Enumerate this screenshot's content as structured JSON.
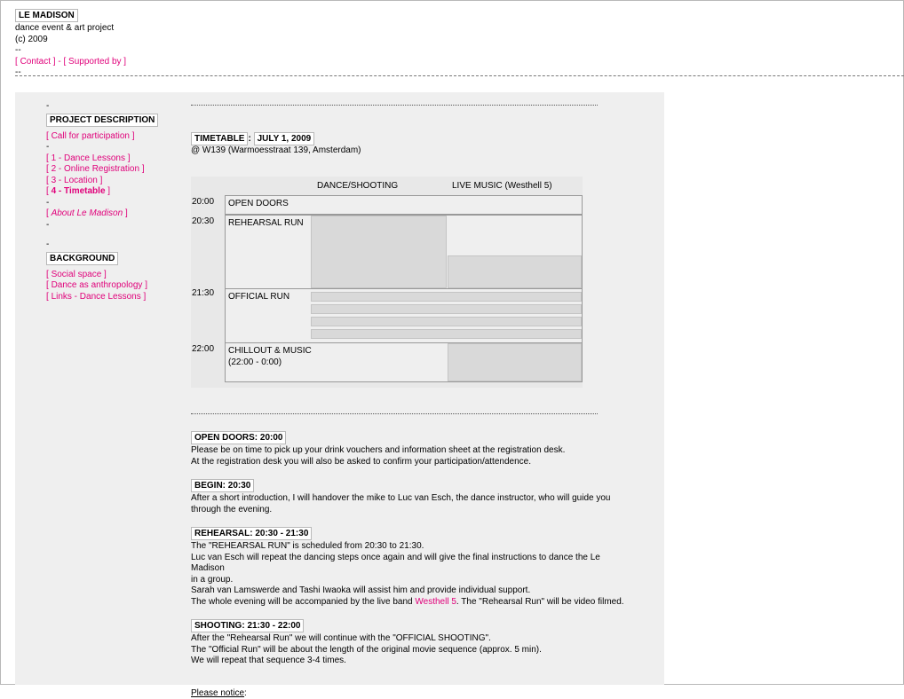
{
  "site": {
    "title": "LE MADISON",
    "subtitle": "dance event & art project",
    "copyright": "(c) 2009",
    "sep1": "--",
    "sep2": "--",
    "links": [
      {
        "label": "Contact"
      },
      {
        "label": "Supported by"
      }
    ]
  },
  "nav": {
    "dash_top": "-",
    "heading1": "PROJECT DESCRIPTION",
    "call": "Call for participation",
    "d1": "-",
    "items": [
      {
        "label": "1 - Dance Lessons"
      },
      {
        "label": "2 - Online Registration"
      },
      {
        "label": "3 - Location"
      },
      {
        "label": "4 - Timetable"
      }
    ],
    "d2": "-",
    "about": "About Le Madison",
    "d3": "-",
    "d4": "-",
    "heading2": "BACKGROUND",
    "bg_items": [
      {
        "label": "Social space"
      },
      {
        "label": "Dance as anthropology"
      },
      {
        "label": "Links - Dance Lessons"
      }
    ]
  },
  "timetable": {
    "label": "TIMETABLE",
    "colon": ":",
    "date": "JULY 1, 2009",
    "venue": "@ W139 (Warmoesstraat 139, Amsterdam)",
    "col1": "DANCE/SHOOTING",
    "col2": "LIVE MUSIC (Westhell 5)",
    "rows": [
      {
        "time": "20:00",
        "label": "OPEN DOORS"
      },
      {
        "time": "20:30",
        "label": "REHEARSAL RUN"
      },
      {
        "time": "21:30",
        "label": "OFFICIAL RUN"
      },
      {
        "time": "22:00",
        "label": "CHILLOUT & MUSIC",
        "sub": "(22:00 - 0:00)"
      }
    ]
  },
  "sections": {
    "open": {
      "title": "OPEN DOORS: 20:00",
      "lines": [
        "Please be on time to pick up your drink vouchers and information sheet at the registration desk.",
        "At the registration desk you will also be asked to confirm your participation/attendence."
      ]
    },
    "begin": {
      "title": "BEGIN: 20:30",
      "lines": [
        "After a short introduction, I will handover the mike to Luc van Esch, the dance instructor, who will guide you",
        "through the evening."
      ]
    },
    "rehearsal": {
      "title": "REHEARSAL: 20:30 - 21:30",
      "lines": [
        "The \"REHEARSAL RUN\" is scheduled from 20:30 to 21:30.",
        "Luc van Esch will repeat the dancing steps once again and will give the final instructions to dance the Le Madison",
        "in a group.",
        "Sarah van Lamswerde and Tashi Iwaoka will assist him and provide individual support."
      ],
      "last_pre": "The whole evening will be accompanied by the live band ",
      "link": "Westhell 5",
      "last_post": ". The \"Rehearsal Run\" will be video filmed."
    },
    "shooting": {
      "title": "SHOOTING: 21:30 - 22:00",
      "lines": [
        "After the \"Rehearsal Run\" we will continue with the \"OFFICIAL SHOOTING\".",
        "The \"Official Run\" will be about the length of the original movie sequence (approx. 5 min).",
        "We will repeat that sequence 3-4 times."
      ]
    },
    "notice": "Please notice"
  }
}
